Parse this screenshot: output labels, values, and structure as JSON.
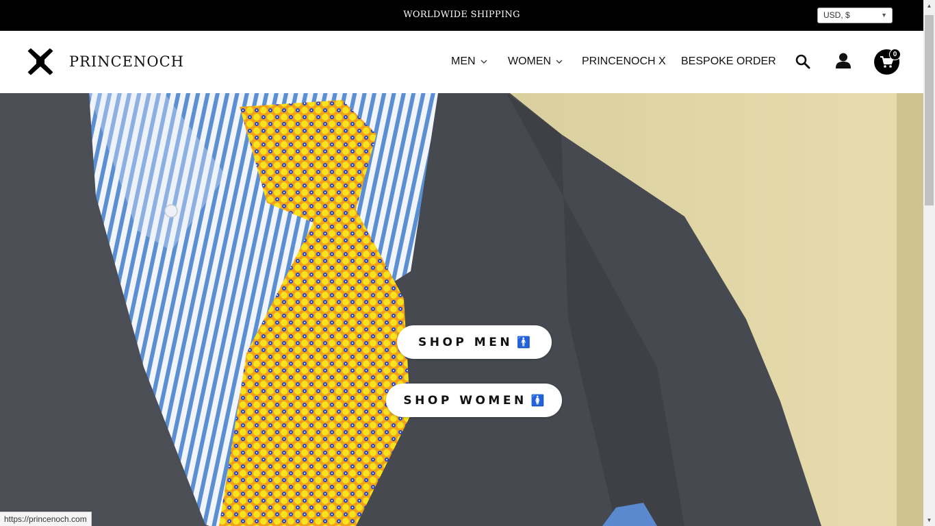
{
  "announcement": {
    "text": "WORLDWIDE SHIPPING"
  },
  "currency": {
    "selected": "USD, $"
  },
  "brand": {
    "name": "PRINCENOCH"
  },
  "nav": {
    "items": [
      {
        "label": "MEN",
        "has_dropdown": true
      },
      {
        "label": "WOMEN",
        "has_dropdown": true
      },
      {
        "label": "PRINCENOCH X",
        "has_dropdown": false
      },
      {
        "label": "BESPOKE ORDER",
        "has_dropdown": false
      }
    ]
  },
  "header_icons": {
    "search": "search-icon",
    "account": "user-icon",
    "cart": "cart-icon"
  },
  "cart": {
    "count": "0"
  },
  "hero": {
    "shop_men_label": "SHOP MEN",
    "shop_men_icon": "🚹",
    "shop_women_label": "SHOP WOMEN",
    "shop_women_icon": "🚺"
  },
  "status_bar": {
    "url": "https://princenoch.com"
  },
  "colors": {
    "top_bar": "#000000",
    "header_bg": "#ffffff",
    "button_bg": "#ffffff",
    "text": "#111111"
  }
}
